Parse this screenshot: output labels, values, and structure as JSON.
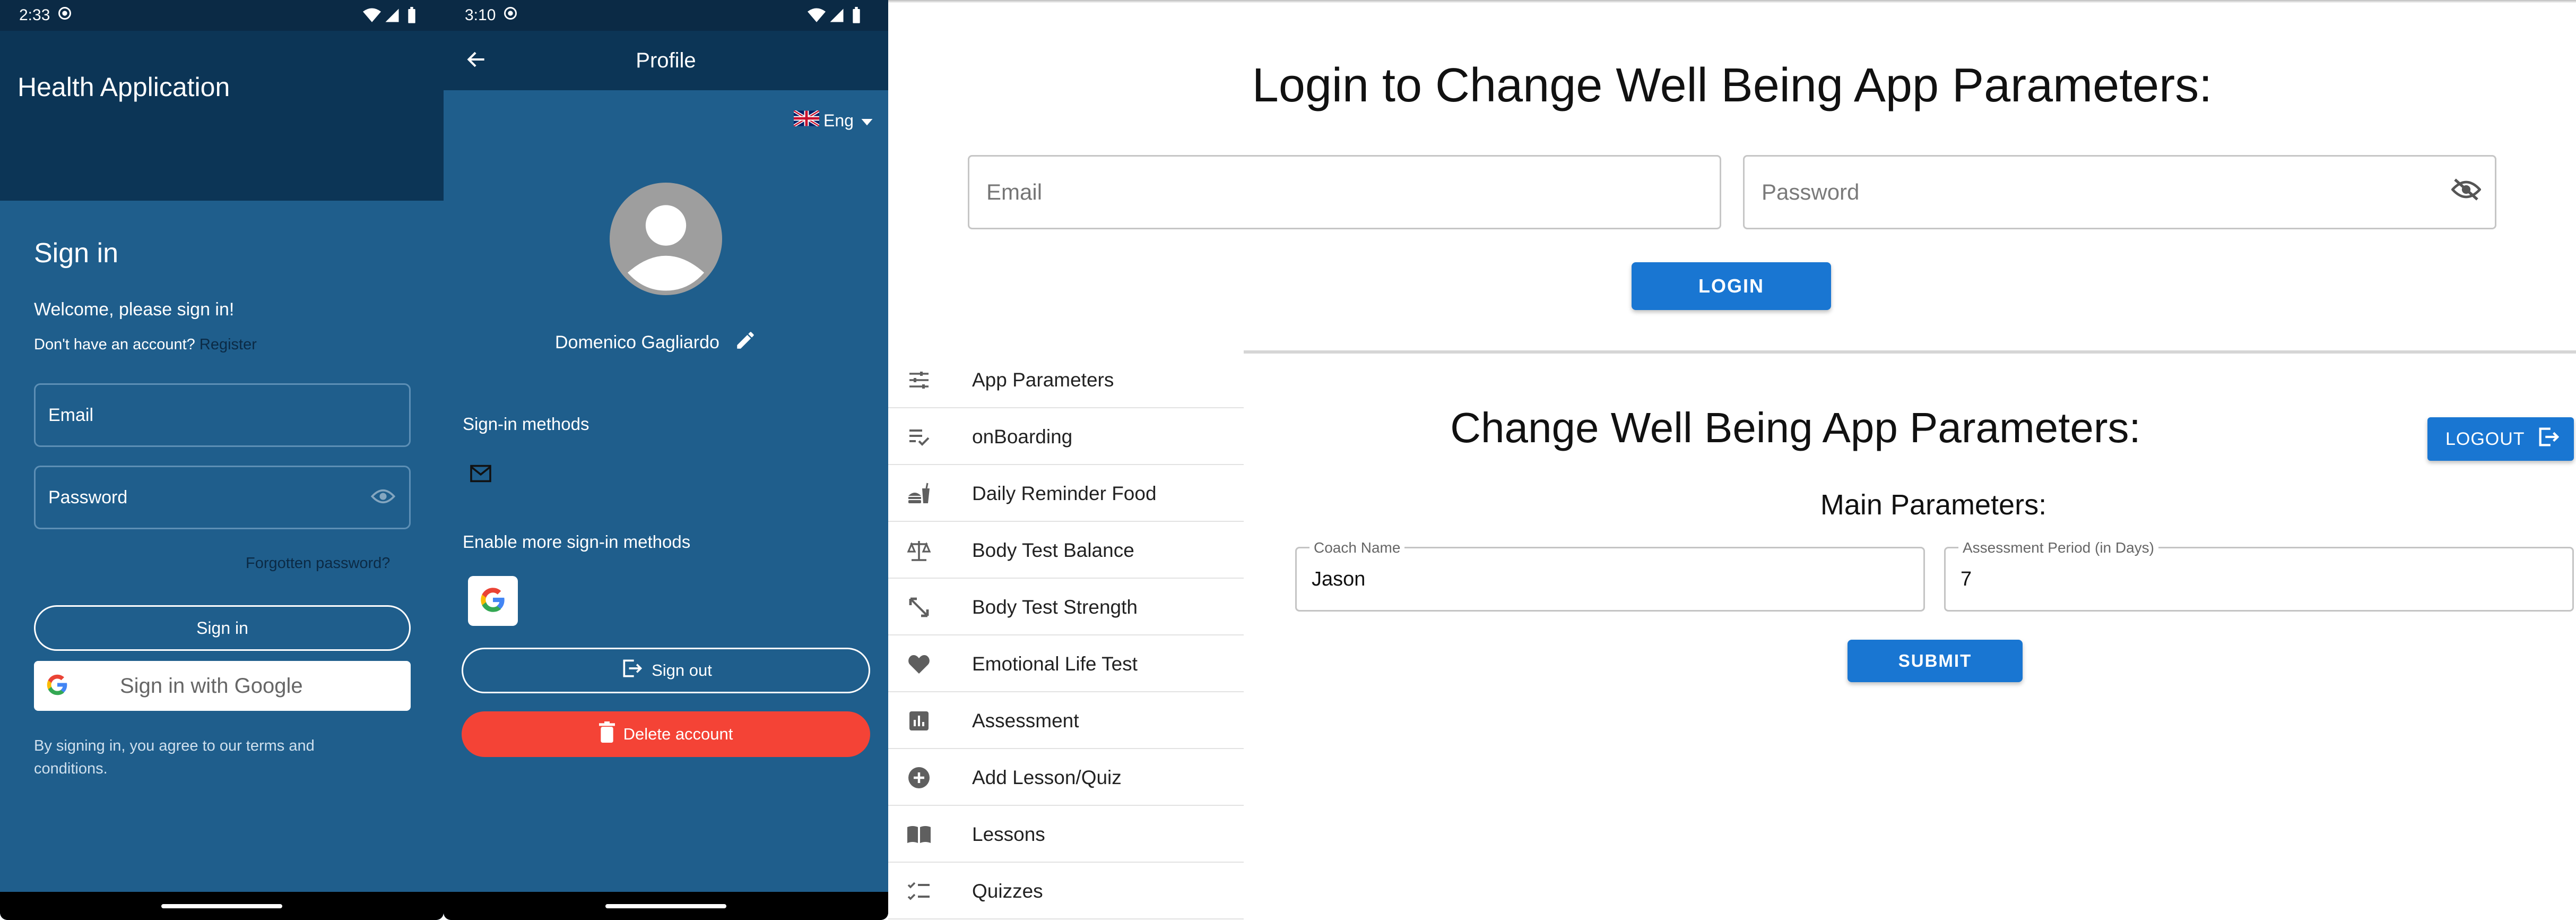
{
  "phone1": {
    "status": {
      "time": "2:33"
    },
    "app_title": "Health Application",
    "signin_title": "Sign in",
    "welcome": "Welcome, please sign in!",
    "no_account": "Don't have an account?",
    "register": "Register",
    "email_label": "Email",
    "password_label": "Password",
    "forgot": "Forgotten password?",
    "signin_button": "Sign in",
    "google_button": "Sign in with Google",
    "terms": "By signing in, you agree to our terms and conditions."
  },
  "phone2": {
    "status": {
      "time": "3:10"
    },
    "title": "Profile",
    "language": "Eng",
    "user_name": "Domenico Gagliardo",
    "signin_methods": "Sign-in methods",
    "enable_more": "Enable more sign-in methods",
    "sign_out": "Sign out",
    "delete_account": "Delete account"
  },
  "web": {
    "login_title": "Login to Change Well Being App Parameters:",
    "email_placeholder": "Email",
    "password_placeholder": "Password",
    "login_button": "LOGIN",
    "sidebar": [
      {
        "label": "App Parameters",
        "icon": "sliders-icon"
      },
      {
        "label": "onBoarding",
        "icon": "playlist-check-icon"
      },
      {
        "label": "Daily Reminder Food",
        "icon": "fastfood-icon"
      },
      {
        "label": "Body Test Balance",
        "icon": "scale-balance-icon"
      },
      {
        "label": "Body Test Strength",
        "icon": "expand-arrows-icon"
      },
      {
        "label": "Emotional Life Test",
        "icon": "heart-icon"
      },
      {
        "label": "Assessment",
        "icon": "bar-chart-icon"
      },
      {
        "label": "Add Lesson/Quiz",
        "icon": "add-circle-icon"
      },
      {
        "label": "Lessons",
        "icon": "book-icon"
      },
      {
        "label": "Quizzes",
        "icon": "checklist-icon"
      }
    ],
    "change_title": "Change Well Being App Parameters:",
    "logout_button": "LOGOUT",
    "main_params": "Main Parameters:",
    "coach_label": "Coach Name",
    "coach_value": "Jason",
    "period_label": "Assessment Period (in Days)",
    "period_value": "7",
    "submit_button": "SUBMIT"
  },
  "colors": {
    "phone_bg": "#1f5e8c",
    "phone_header": "#0c3556",
    "delete_red": "#f44336",
    "web_button_blue": "#1976d2"
  }
}
